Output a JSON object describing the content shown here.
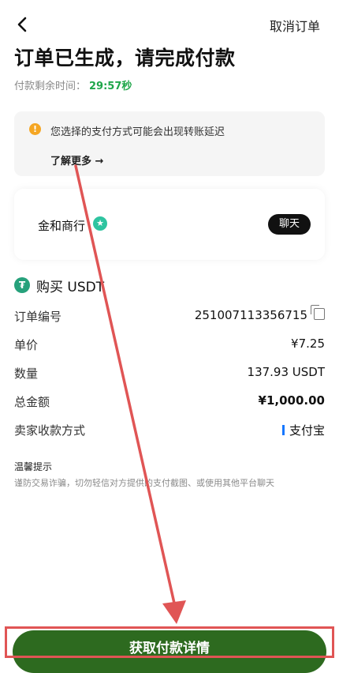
{
  "header": {
    "back_icon": "chevron-left-icon",
    "cancel_label": "取消订单"
  },
  "title": "订单已生成，请完成付款",
  "timer": {
    "label": "付款剩余时间：",
    "value": "29:57秒"
  },
  "notice": {
    "icon": "warning-icon",
    "message": "您选择的支付方式可能会出现转账延迟",
    "more_label": "了解更多 →"
  },
  "merchant": {
    "name": "金和商行",
    "badge_icon": "verified-star-icon",
    "chat_label": "聊天"
  },
  "order": {
    "coin_icon": "usdt-icon",
    "heading": "购买 USDT",
    "rows": [
      {
        "label": "订单编号",
        "value": "251007113356715"
      },
      {
        "label": "单价",
        "value": "¥7.25"
      },
      {
        "label": "数量",
        "value": "137.93 USDT"
      },
      {
        "label": "总金额",
        "value": "¥1,000.00"
      },
      {
        "label": "卖家收款方式",
        "value": "支付宝"
      }
    ]
  },
  "tip": {
    "title": "温馨提示",
    "body": "谨防交易诈骗，切勿轻信对方提供的支付截图、或使用其他平台聊天"
  },
  "cta": {
    "label": "获取付款详情"
  },
  "colors": {
    "accent_green": "#1fa64a",
    "cta_green": "#2d6a1f",
    "annotation_red": "#e05555"
  }
}
